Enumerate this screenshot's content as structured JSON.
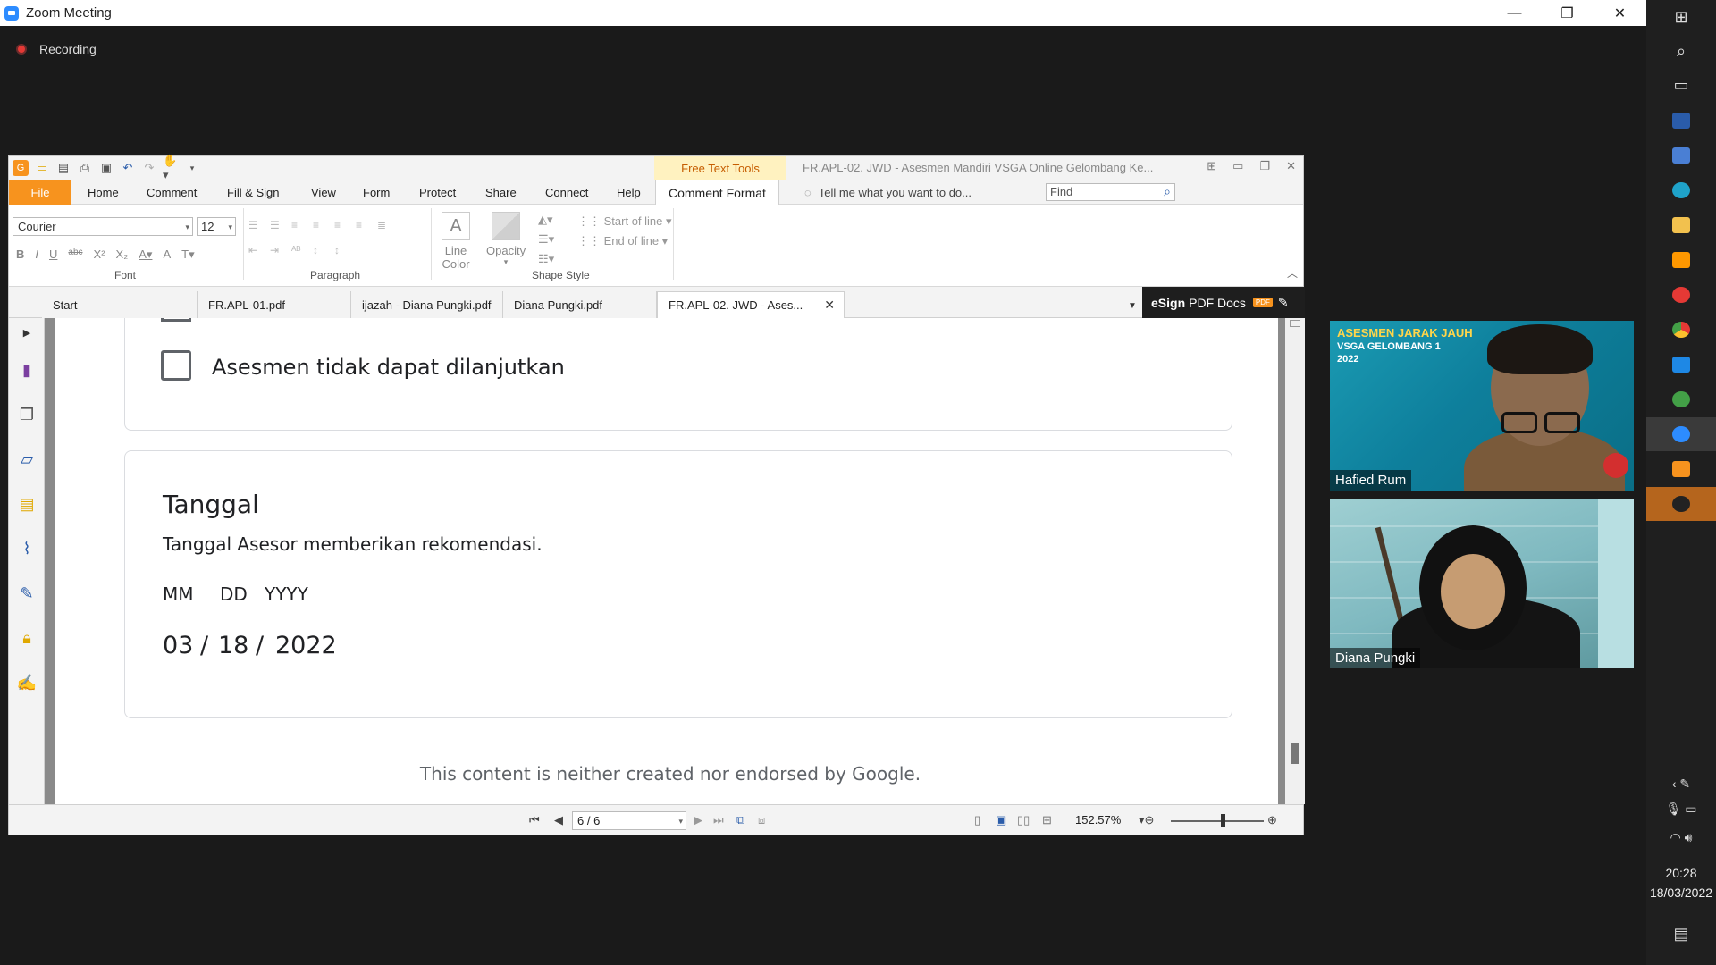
{
  "zoom": {
    "window_title": "Zoom Meeting",
    "recording_label": "Recording",
    "participants": [
      {
        "name": "Hafied Rum",
        "banner_line1": "ASESMEN JARAK JAUH",
        "banner_line2": "VSGA GELOMBANG 1",
        "banner_line3": "2022"
      },
      {
        "name": "Diana Pungki"
      }
    ]
  },
  "taskbar": {
    "time": "20:28",
    "date": "18/03/2022"
  },
  "pdf_app": {
    "contextual_tab": "Free Text Tools",
    "doc_title": "FR.APL-02. JWD - Asesmen Mandiri VSGA Online Gelombang Ke...",
    "menu": {
      "file": "File",
      "items": [
        "Home",
        "Comment",
        "Fill & Sign",
        "View",
        "Form",
        "Protect",
        "Share",
        "Connect",
        "Help"
      ],
      "active": "Comment Format"
    },
    "tell_me": "Tell me what you want to do...",
    "find_placeholder": "Find",
    "ribbon": {
      "font_name": "Courier",
      "font_size": "12",
      "font_group": "Font",
      "paragraph_group": "Paragraph",
      "shape_group": "Shape Style",
      "line_color_1": "Line",
      "line_color_2": "Color",
      "opacity": "Opacity",
      "start_of_line": "Start of line",
      "end_of_line": "End of line"
    },
    "tabs": [
      "Start",
      "FR.APL-01.pdf",
      "ijazah - Diana Pungki.pdf",
      "Diana Pungki.pdf",
      "FR.APL-02. JWD - Ases..."
    ],
    "esign_bold": "eSign",
    "esign_rest": "PDF Docs",
    "esign_badge": "PDF",
    "page_indicator": "6 / 6",
    "zoom_level": "152.57%"
  },
  "document": {
    "option_label": "Asesmen tidak dapat dilanjutkan",
    "question_title": "Tanggal",
    "question_desc": "Tanggal Asesor memberikan rekomendasi.",
    "date_labels": {
      "mm": "MM",
      "dd": "DD",
      "yyyy": "YYYY"
    },
    "date_value": {
      "month": "03",
      "day": "18",
      "year": "2022",
      "sep": "/"
    },
    "footer": "This content is neither created nor endorsed by Google."
  },
  "colors": {
    "accent_orange": "#f7931e",
    "zoom_blue": "#2d8cff",
    "recording_red": "#e53935"
  }
}
